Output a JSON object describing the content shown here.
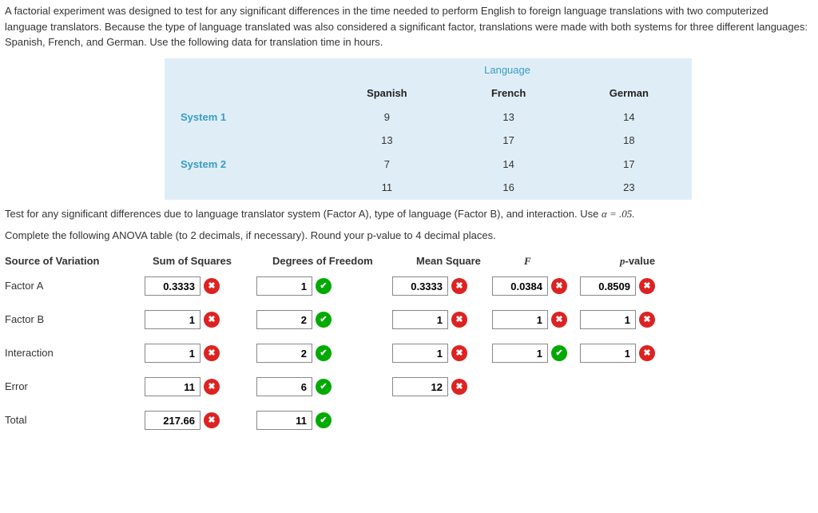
{
  "intro": "A factorial experiment was designed to test for any significant differences in the time needed to perform English to foreign language translations with two computerized language translators. Because the type of language translated was also considered a significant factor, translations were made with both systems for three different languages: Spanish, French, and German. Use the following data for translation time in hours.",
  "data_table": {
    "top_header": "Language",
    "cols": [
      "Spanish",
      "French",
      "German"
    ],
    "rows": [
      {
        "label": "System 1",
        "vals": [
          "9",
          "13",
          "14"
        ]
      },
      {
        "label": "",
        "vals": [
          "13",
          "17",
          "18"
        ]
      },
      {
        "label": "System 2",
        "vals": [
          "7",
          "14",
          "17"
        ]
      },
      {
        "label": "",
        "vals": [
          "11",
          "16",
          "23"
        ]
      }
    ]
  },
  "test_line_a": "Test for any significant differences due to language translator system (Factor A), type of language (Factor B), and interaction. Use ",
  "alpha_expr": "α = .05.",
  "complete_line": "Complete the following ANOVA table (to 2 decimals, if necessary). Round your p-value to 4 decimal places.",
  "anova_headers": {
    "src": "Source of Variation",
    "ss": "Sum of Squares",
    "df": "Degrees of Freedom",
    "ms": "Mean Square",
    "f": "F",
    "p": "p-value"
  },
  "anova": [
    {
      "label": "Factor A",
      "ss": {
        "val": "0.3333",
        "correct": false
      },
      "df": {
        "val": "1",
        "correct": true
      },
      "ms": {
        "val": "0.3333",
        "correct": false
      },
      "f": {
        "val": "0.0384",
        "correct": false
      },
      "p": {
        "val": "0.8509",
        "correct": false
      }
    },
    {
      "label": "Factor B",
      "ss": {
        "val": "1",
        "correct": false
      },
      "df": {
        "val": "2",
        "correct": true
      },
      "ms": {
        "val": "1",
        "correct": false
      },
      "f": {
        "val": "1",
        "correct": false
      },
      "p": {
        "val": "1",
        "correct": false
      }
    },
    {
      "label": "Interaction",
      "ss": {
        "val": "1",
        "correct": false
      },
      "df": {
        "val": "2",
        "correct": true
      },
      "ms": {
        "val": "1",
        "correct": false
      },
      "f": {
        "val": "1",
        "correct": true
      },
      "p": {
        "val": "1",
        "correct": false
      }
    },
    {
      "label": "Error",
      "ss": {
        "val": "11",
        "correct": false
      },
      "df": {
        "val": "6",
        "correct": true
      },
      "ms": {
        "val": "12",
        "correct": false
      }
    },
    {
      "label": "Total",
      "ss": {
        "val": "217.66",
        "correct": false
      },
      "df": {
        "val": "11",
        "correct": true
      }
    }
  ]
}
